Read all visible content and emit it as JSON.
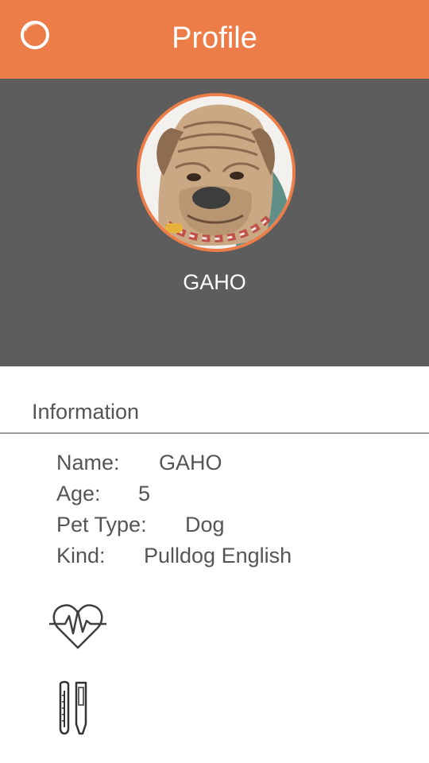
{
  "header": {
    "title": "Profile",
    "menu_icon": "circle-menu-icon",
    "bg_color": "#ec7c48"
  },
  "profile": {
    "name": "GAHO",
    "avatar_icon": "dog-avatar",
    "ring_color": "#ec7c48",
    "hero_bg_color": "#5d5d5d"
  },
  "information": {
    "heading": "Information",
    "rows": [
      {
        "label": "Name:",
        "value": "GAHO"
      },
      {
        "label": "Age:",
        "value": "5"
      },
      {
        "label": "Pet Type:",
        "value": "Dog"
      },
      {
        "label": "Kind:",
        "value": "Pulldog English"
      }
    ]
  },
  "actions": {
    "health_icon": "heart-rate-icon",
    "temperature_icon": "thermometer-icon"
  }
}
